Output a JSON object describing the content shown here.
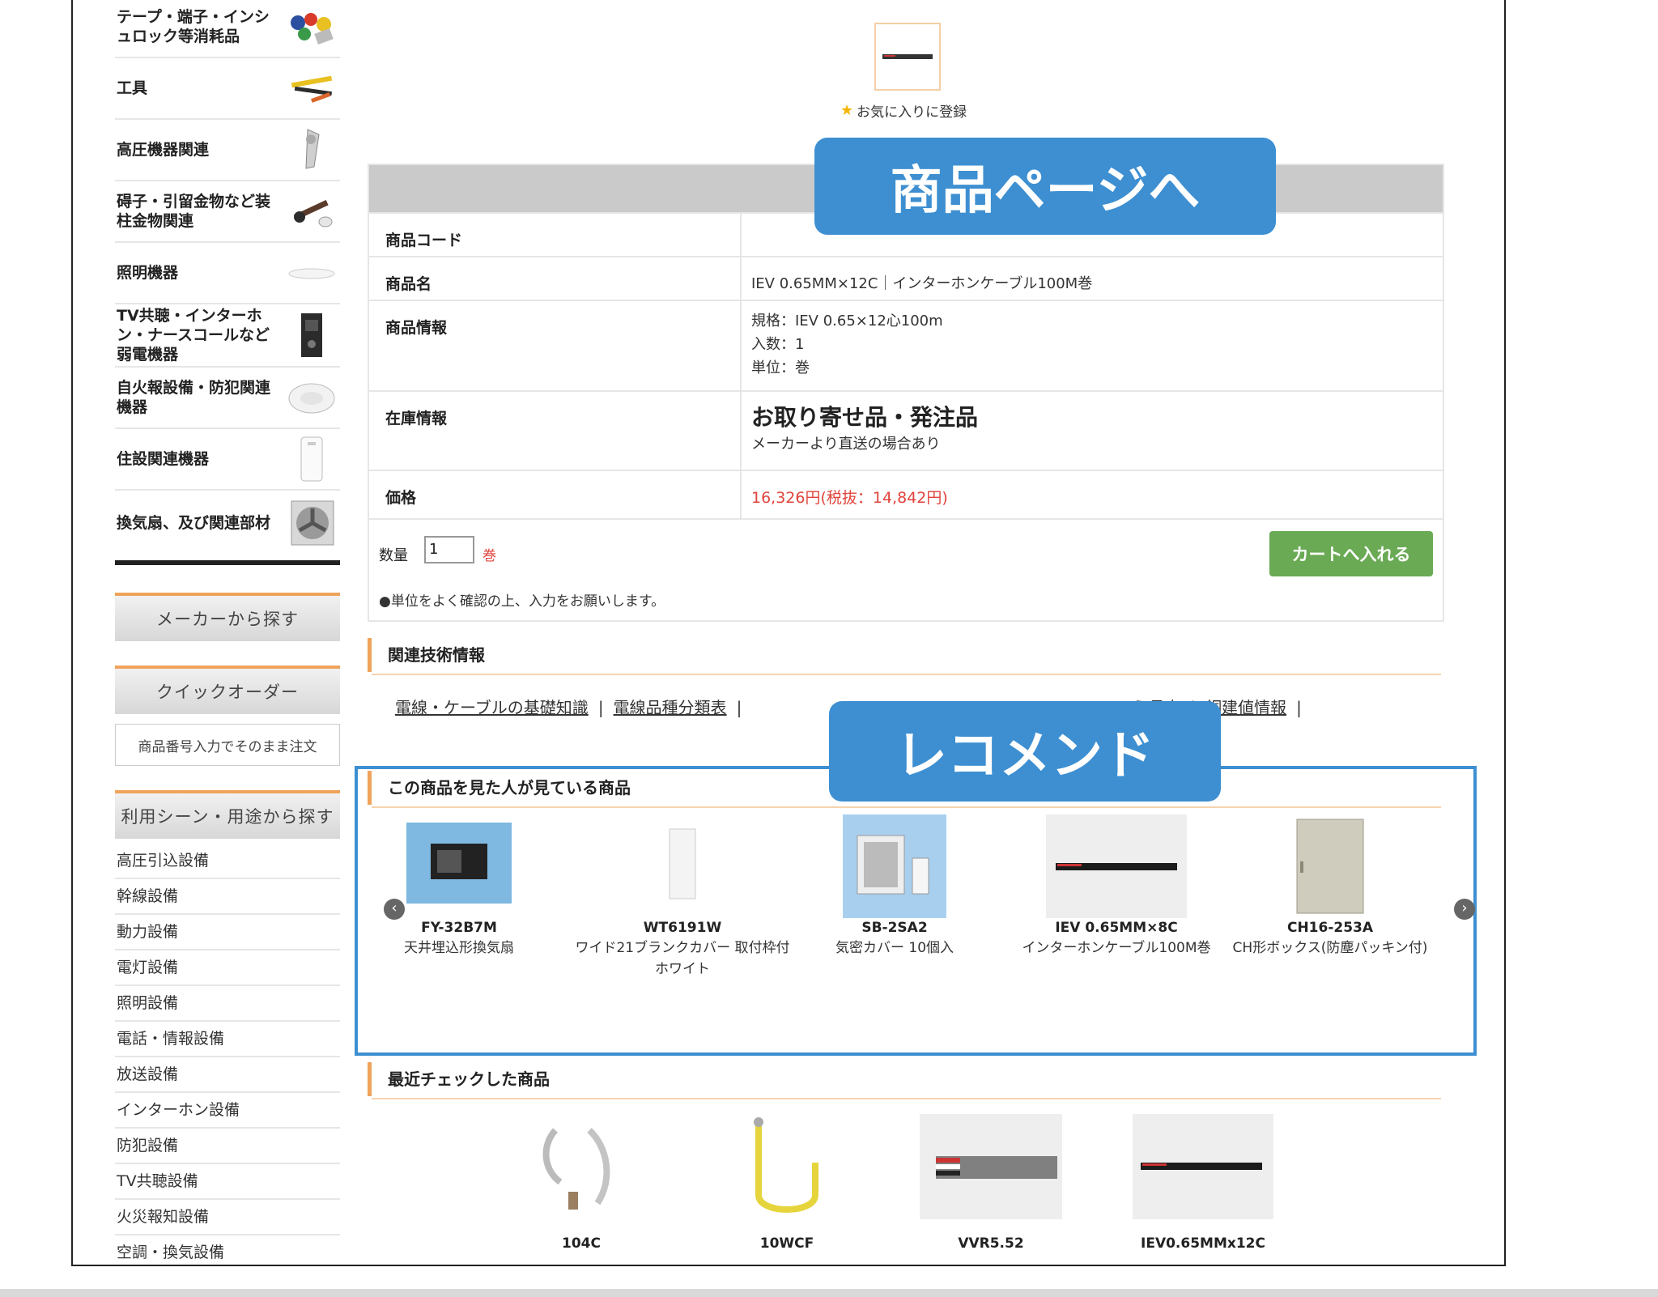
{
  "sidebar": {
    "categories": [
      {
        "label": "テープ・端子・インシュロック等消耗品",
        "icon": "consumables-icon"
      },
      {
        "label": "工具",
        "icon": "tools-icon"
      },
      {
        "label": "高圧機器関連",
        "icon": "high-voltage-icon"
      },
      {
        "label": "碍子・引留金物など装柱金物関連",
        "icon": "insulator-icon"
      },
      {
        "label": "照明機器",
        "icon": "ceiling-light-icon"
      },
      {
        "label": "TV共聴・インターホン・ナースコールなど弱電機器",
        "icon": "intercom-icon"
      },
      {
        "label": "自火報設備・防犯関連機器",
        "icon": "smoke-detector-icon"
      },
      {
        "label": "住設関連機器",
        "icon": "housing-equipment-icon"
      },
      {
        "label": "換気扇、及び関連部材",
        "icon": "ventilation-fan-icon"
      }
    ],
    "maker_search": "メーカーから探す",
    "quick_order": "クイックオーダー",
    "quick_order_placeholder": "商品番号入力でそのまま注文",
    "scene_search": "利用シーン・用途から探す",
    "scenes": [
      "高圧引込設備",
      "幹線設備",
      "動力設備",
      "電灯設備",
      "照明設備",
      "電話・情報設備",
      "放送設備",
      "インターホン設備",
      "防犯設備",
      "TV共聴設備",
      "火災報知設備",
      "空調・換気設備"
    ]
  },
  "favorite": {
    "label": "お気に入りに登録"
  },
  "callouts": {
    "product_page": "商品ページへ",
    "recommend": "レコメンド"
  },
  "product": {
    "code_label": "商品コード",
    "code_value": "",
    "name_label": "商品名",
    "name_value": "IEV 0.65MM×12C｜インターホンケーブル100M巻",
    "info_label": "商品情報",
    "info_lines": [
      "規格：IEV 0.65×12心100m",
      "入数：1",
      "単位：巻"
    ],
    "stock_label": "在庫情報",
    "stock_main": "お取り寄せ品・発注品",
    "stock_sub": "メーカーより直送の場合あり",
    "price_label": "価格",
    "price_value": "16,326円(税抜：14,842円)",
    "qty_label": "数量",
    "qty_value": "1",
    "qty_unit": "巻",
    "qty_note": "●単位をよく確認の上、入力をお願いします。",
    "cart_button": "カートへ入れる"
  },
  "tech_info": {
    "title": "関連技術情報",
    "links": [
      "電線・ケーブルの基礎知識",
      "電線品種分類表",
      "う長表",
      "銅建値情報"
    ]
  },
  "recommend": {
    "title": "この商品を見た人が見ている商品",
    "items": [
      {
        "code": "FY-32B7M",
        "name": "天井埋込形換気扇"
      },
      {
        "code": "WT6191W",
        "name": "ワイド21ブランクカバー 取付枠付 ホワイト"
      },
      {
        "code": "SB-2SA2",
        "name": "気密カバー 10個入"
      },
      {
        "code": "IEV 0.65MM×8C",
        "name": "インターホンケーブル100M巻"
      },
      {
        "code": "CH16-253A",
        "name": "CH形ボックス(防塵パッキン付)"
      }
    ]
  },
  "recent": {
    "title": "最近チェックした商品",
    "items": [
      {
        "code": "104C"
      },
      {
        "code": "10WCF"
      },
      {
        "code": "VVR5.52"
      },
      {
        "code": "IEV0.65MMx12C"
      }
    ]
  },
  "colors": {
    "accent_orange": "#f0a35b",
    "callout_blue": "#3d8fd1",
    "cart_green": "#6aaa55",
    "price_red": "#e0443c"
  }
}
